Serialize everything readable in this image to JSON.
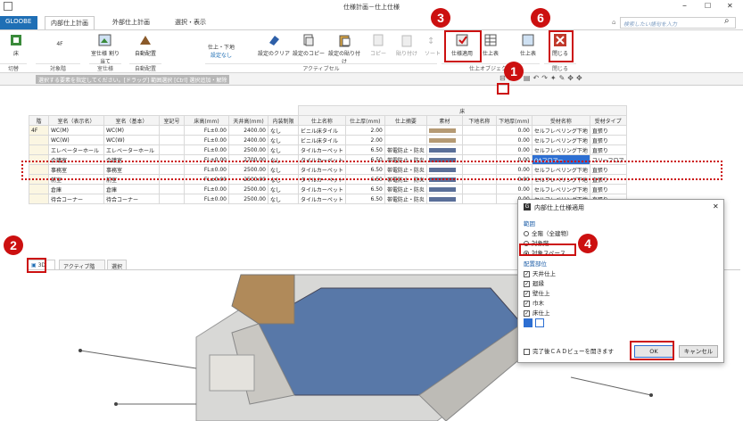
{
  "window": {
    "title": "仕様計画－仕上仕様",
    "minimize": "–",
    "maximize": "☐",
    "close": "✕"
  },
  "menu": {
    "brand": "GLOOBE",
    "tabs": [
      "内部仕上計画",
      "外部仕上計画",
      "選択・表示"
    ]
  },
  "search": {
    "placeholder": "検索したい語句を入力"
  },
  "ribbon": {
    "buttons": {
      "floor": "床",
      "floor_value": "4F",
      "room_spec": "室仕様\n割り当て",
      "auto_place1": "自動配置",
      "finish_floor": "仕上・下地",
      "finish_setting": "設定なし",
      "clear": "設定のクリア",
      "copy_setting": "設定のコピー",
      "paste_setting": "設定の貼り付け",
      "copy": "コピー",
      "paste": "貼り付け",
      "sort": "ソート",
      "apply": "仕様適用",
      "table": "仕上表",
      "tbl2": "仕上表",
      "close": "閉じる"
    },
    "groups": [
      "切替",
      "対象階",
      "室仕様",
      "自動配置",
      "アクティブセル",
      "仕上オブジェクト",
      "閉じる"
    ]
  },
  "status": {
    "hint": "選択する要素を指定してください。[ドラッグ] 範囲選択 [Ctrl] 選択追加・解除"
  },
  "table": {
    "floor_group": "床",
    "headers": [
      "階",
      "室名（表示名）",
      "室名（基本）",
      "室記号",
      "床高(mm)",
      "天井高(mm)",
      "内装制限",
      "仕上名称",
      "仕上厚(mm)",
      "仕上摘要",
      "素材",
      "下地名称",
      "下地厚(mm)",
      "受材名称",
      "受材タイプ"
    ],
    "rows": [
      [
        "4F",
        "WC(M)",
        "WC(M)",
        "",
        "FL±0.00",
        "2400.00",
        "なし",
        "ビニル床タイル",
        "2.00",
        "",
        "",
        "",
        "0.00",
        "セルフレベリング下地",
        "直張り"
      ],
      [
        "",
        "WC(W)",
        "WC(W)",
        "",
        "FL±0.00",
        "2400.00",
        "なし",
        "ビニル床タイル",
        "2.00",
        "",
        "",
        "",
        "0.00",
        "セルフレベリング下地",
        "直張り"
      ],
      [
        "",
        "エレベーターホール",
        "エレベーターホール",
        "",
        "FL±0.00",
        "2500.00",
        "なし",
        "タイルカーペット",
        "6.50",
        "帯電防止・防炎",
        "",
        "",
        "0.00",
        "セルフレベリング下地",
        "直張り"
      ],
      [
        "",
        "会議室",
        "会議室",
        "",
        "FL±0.00",
        "2700.00",
        "なし",
        "タイルカーペット",
        "6.50",
        "帯電防止・防炎",
        "",
        "",
        "0.00",
        "OAフロアー",
        "フリーフロア"
      ],
      [
        "",
        "事務室",
        "事務室",
        "",
        "FL±0.00",
        "2500.00",
        "なし",
        "タイルカーペット",
        "6.50",
        "帯電防止・防炎",
        "",
        "",
        "0.00",
        "セルフレベリング下地",
        "直張り"
      ],
      [
        "",
        "前室",
        "前室",
        "",
        "FL±0.00",
        "2500.00",
        "なし",
        "タイルカーペット",
        "6.50",
        "帯電防止・防炎",
        "",
        "",
        "0.00",
        "セルフレベリング下地",
        "直張り"
      ],
      [
        "",
        "倉庫",
        "倉庫",
        "",
        "FL±0.00",
        "2500.00",
        "なし",
        "タイルカーペット",
        "6.50",
        "帯電防止・防炎",
        "",
        "",
        "0.00",
        "セルフレベリング下地",
        "直張り"
      ],
      [
        "",
        "待合コーナー",
        "待合コーナー",
        "",
        "FL±0.00",
        "2500.00",
        "なし",
        "タイルカーペット",
        "6.50",
        "帯電防止・防炎",
        "",
        "",
        "0.00",
        "セルフレベリング下地",
        "直張り"
      ]
    ]
  },
  "bottom_tabs": [
    "3D",
    "アクティブ階",
    "選択"
  ],
  "dialog": {
    "title": "内部仕上仕様適用",
    "range_label": "範囲",
    "range_options": [
      "全階（全建物）",
      "対象階",
      "対象スペース"
    ],
    "parts_label": "配置部位",
    "parts": [
      "天井仕上",
      "廻縁",
      "壁仕上",
      "巾木",
      "床仕上"
    ],
    "open_cad": "完了後ＣＡＤビューを開きます",
    "ok": "OK",
    "cancel": "キャンセル"
  },
  "callouts": [
    "1",
    "2",
    "3",
    "4",
    "6"
  ],
  "colors": {
    "accent": "#cc1010",
    "brand": "#1f6fb5",
    "selection": "#2d6fd2"
  }
}
